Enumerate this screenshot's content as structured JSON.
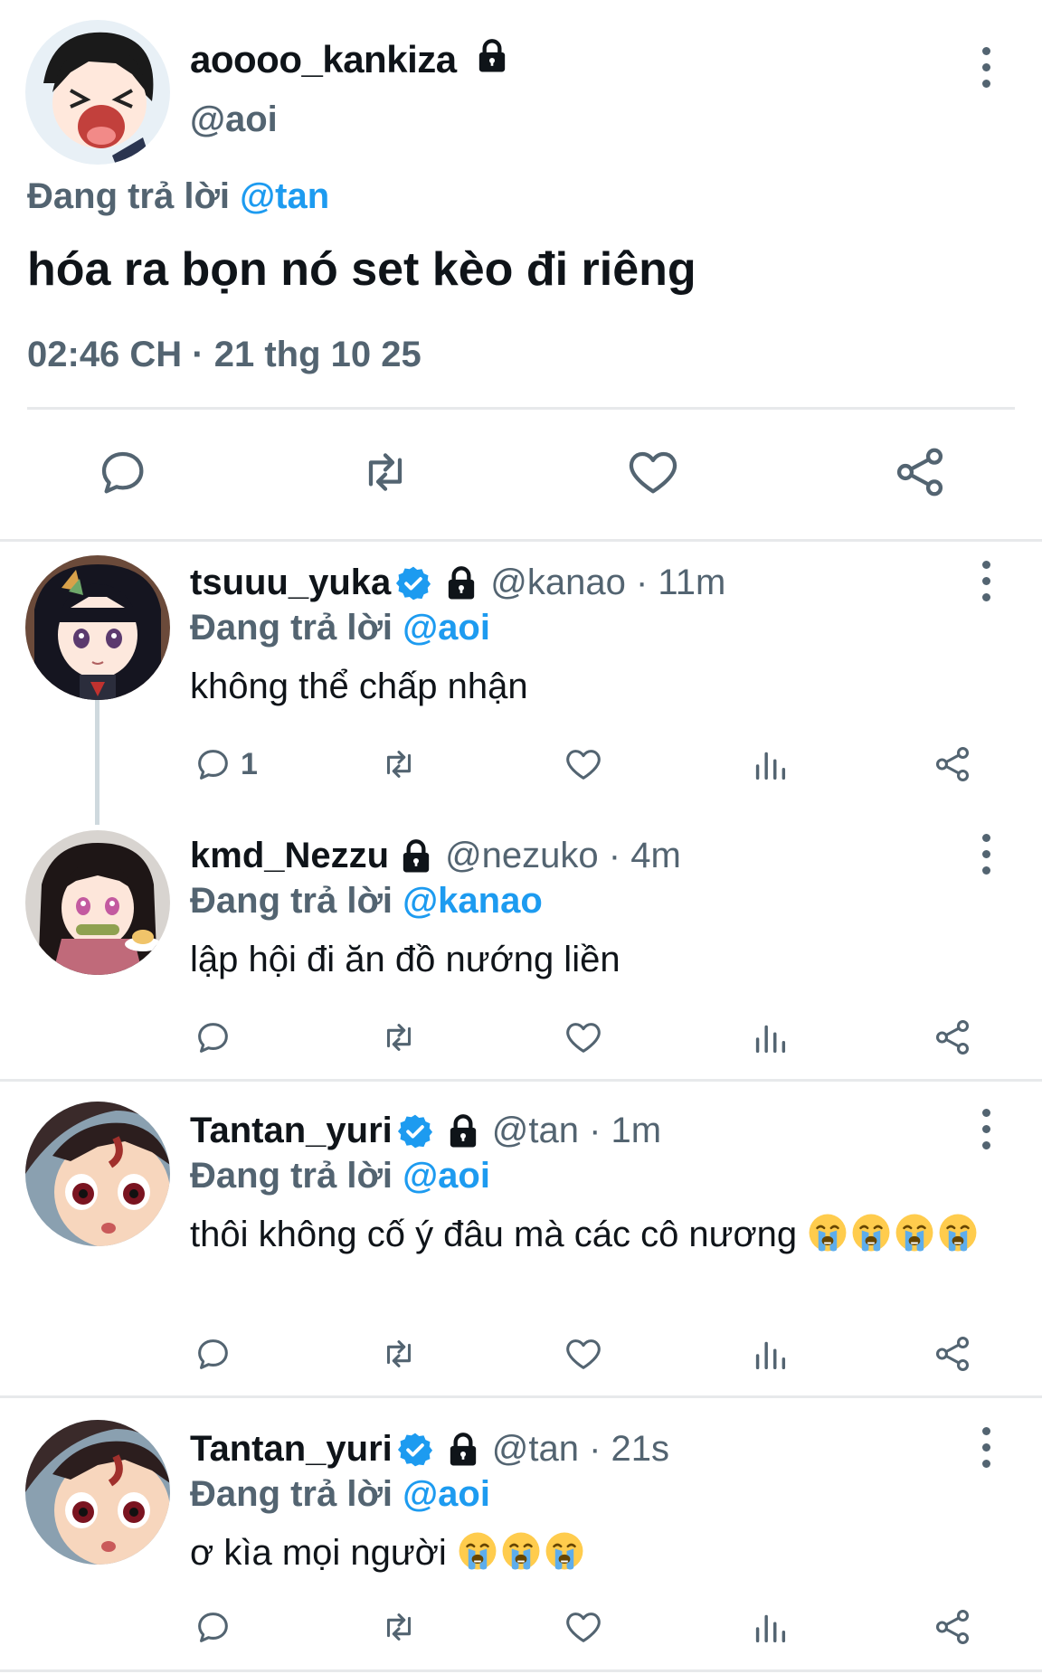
{
  "main_tweet": {
    "display_name": "aoooo_kankiza",
    "handle": "@aoi",
    "replying_prefix": "Đang trả lời",
    "replying_to": "@tan",
    "text": "hóa ra bọn nó set kèo đi riêng",
    "timestamp": "02:46 CH · 21 thg 10 25",
    "icons": [
      "reply-icon",
      "retweet-icon",
      "like-icon",
      "share-icon"
    ]
  },
  "replies": [
    {
      "display_name": "tsuuu_yuka",
      "verified": true,
      "locked": true,
      "meta": "@kanao · 11m",
      "replying_prefix": "Đang trả lời",
      "replying_to": "@aoi",
      "text": "không thể chấp nhận",
      "reply_count": "1",
      "emoji_count": 0
    },
    {
      "display_name": "kmd_Nezzu",
      "verified": false,
      "locked": true,
      "meta": "@nezuko · 4m",
      "replying_prefix": "Đang trả lời",
      "replying_to": "@kanao",
      "text": "lập hội đi ăn đồ nướng liền",
      "reply_count": "",
      "emoji_count": 0
    },
    {
      "display_name": "Tantan_yuri",
      "verified": true,
      "locked": true,
      "meta": "@tan · 1m",
      "replying_prefix": "Đang trả lời",
      "replying_to": "@aoi",
      "text": "thôi không cố ý đâu mà các cô nương",
      "reply_count": "",
      "emoji_count": 4
    },
    {
      "display_name": "Tantan_yuri",
      "verified": true,
      "locked": true,
      "meta": "@tan · 21s",
      "replying_prefix": "Đang trả lời",
      "replying_to": "@aoi",
      "text": "ơ kìa mọi người",
      "reply_count": "",
      "emoji_count": 3
    }
  ],
  "colors": {
    "accent": "#1d9bf0",
    "muted": "#536471",
    "text": "#0f1419",
    "divider": "#e7e9eb"
  }
}
